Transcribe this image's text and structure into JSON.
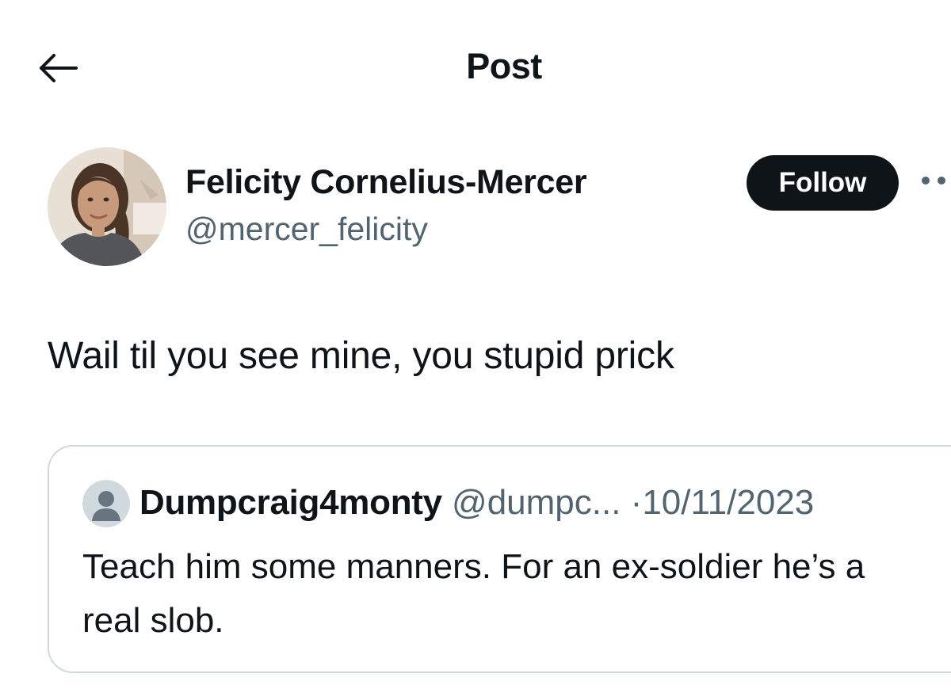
{
  "header": {
    "title": "Post",
    "back_icon": "arrow-left-icon"
  },
  "author": {
    "name": "Felicity Cornelius-Mercer",
    "handle": "@mercer_felicity",
    "follow_label": "Follow",
    "more_icon": "more-horizontal-icon"
  },
  "post": {
    "text": "Wail til you see mine, you stupid prick"
  },
  "quote": {
    "name": "Dumpcraig4monty",
    "handle": "@dumpc...",
    "separator": "·",
    "date": "10/11/2023",
    "text": "Teach him some manners. For an ex-soldier he’s a real slob."
  },
  "colors": {
    "text": "#0f1419",
    "secondary": "#536471",
    "border": "#cfd9de",
    "button_bg": "#0f1419"
  }
}
